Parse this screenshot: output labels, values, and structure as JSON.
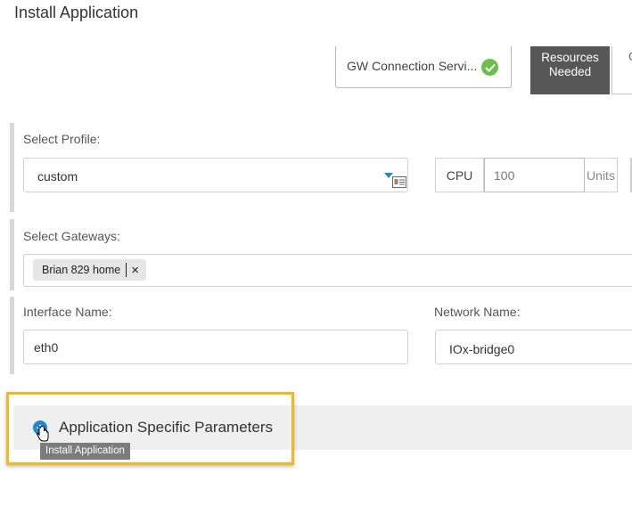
{
  "page": {
    "title": "Install Application"
  },
  "tabs": [
    {
      "label": "GW Connection Servi...",
      "status": "complete"
    },
    {
      "label_line1": "Resources",
      "label_line2": "Needed"
    },
    {
      "label": "C"
    }
  ],
  "profile": {
    "label": "Select Profile:",
    "value": "custom"
  },
  "cpu": {
    "label": "CPU",
    "value": "100",
    "unit": "Units"
  },
  "gateways": {
    "label": "Select Gateways:",
    "selected": [
      "Brian 829 home"
    ],
    "remove_symbol": "×"
  },
  "interface": {
    "label": "Interface Name:",
    "value": "eth0"
  },
  "network": {
    "label": "Network Name:",
    "value": "IOx-bridge0"
  },
  "params": {
    "title": "Application Specific Parameters",
    "expand_symbol": "+",
    "tooltip": "Install Application"
  },
  "colors": {
    "highlight": "#f3b81c",
    "active_tab": "#575757",
    "success": "#6cc04a",
    "accent": "#1f8ad3"
  }
}
